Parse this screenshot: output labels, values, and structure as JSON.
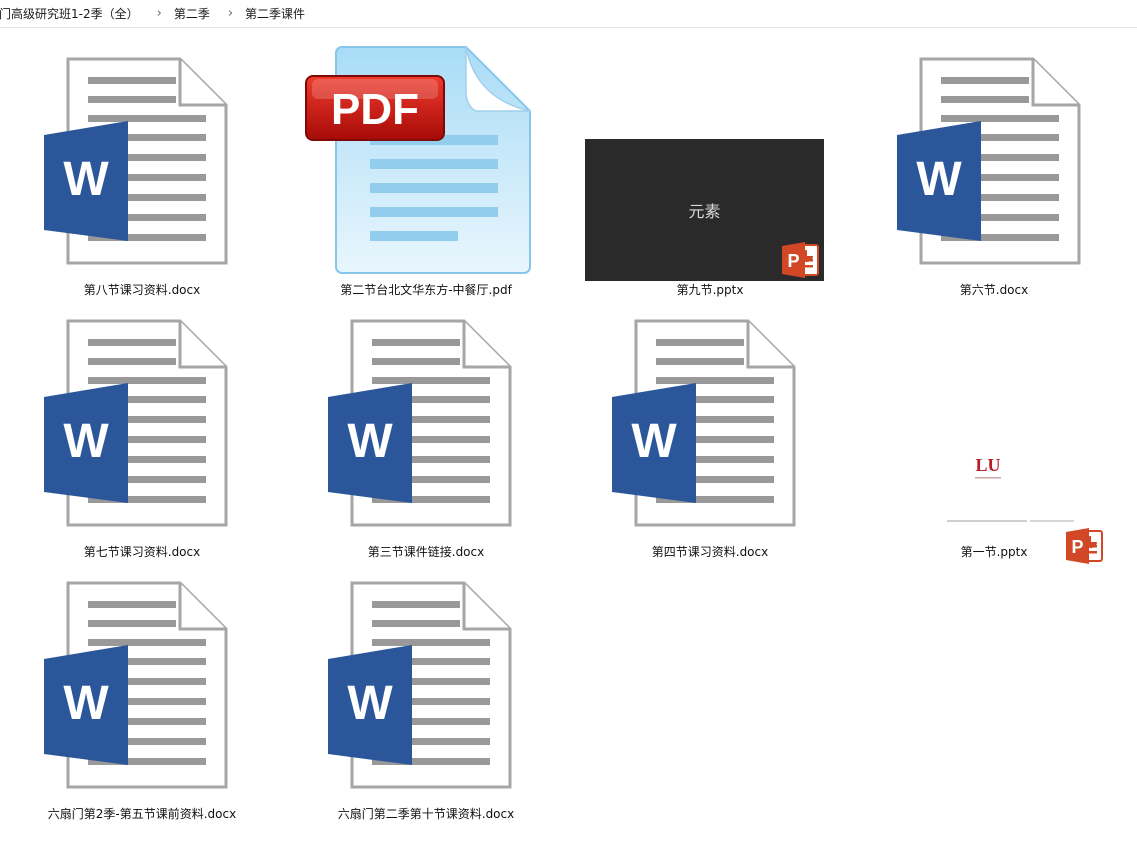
{
  "breadcrumb": {
    "items": [
      "门高级研究班1-2季（全）",
      "第二季",
      "第二季课件"
    ],
    "separator": "›"
  },
  "files": [
    {
      "name": "第八节课习资料.docx",
      "type": "word-icon"
    },
    {
      "name": "第二节台北文华东方-中餐厅.pdf",
      "type": "pdf-icon",
      "badge": "PDF"
    },
    {
      "name": "第九节.pptx",
      "type": "pptx-thumbnail",
      "thumbnail_text": "元素"
    },
    {
      "name": "第六节.docx",
      "type": "word-icon"
    },
    {
      "name": "第七节课习资料.docx",
      "type": "word-icon"
    },
    {
      "name": "第三节课件链接.docx",
      "type": "word-icon"
    },
    {
      "name": "第四节课习资料.docx",
      "type": "word-icon"
    },
    {
      "name": "第一节.pptx",
      "type": "pptx-thumbnail",
      "thumbnail_logo": "LU"
    },
    {
      "name": "六扇门第2季-第五节课前资料.docx",
      "type": "word-icon"
    },
    {
      "name": "六扇门第二季第十节课资料.docx",
      "type": "word-icon"
    }
  ],
  "icons": {
    "word_letter": "W",
    "ppt_letter": "P",
    "word_color": "#2b579a",
    "ppt_color": "#d24726",
    "pdf_badge_color": "#c0110d"
  }
}
